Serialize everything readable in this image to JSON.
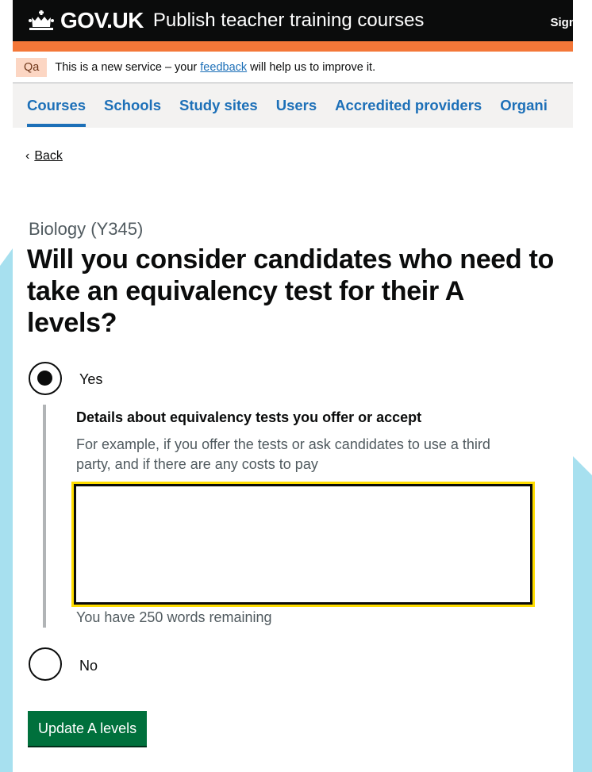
{
  "header": {
    "brand": "GOV.UK",
    "service_name": "Publish teacher training courses",
    "sign_link": "Sign"
  },
  "phase_banner": {
    "tag": "Qa",
    "text_before": "This is a new service – your ",
    "feedback_link": "feedback",
    "text_after": " will help us to improve it."
  },
  "nav": {
    "items": [
      {
        "label": "Courses",
        "active": true
      },
      {
        "label": "Schools"
      },
      {
        "label": "Study sites"
      },
      {
        "label": "Users"
      },
      {
        "label": "Accredited providers"
      },
      {
        "label": "Organi"
      }
    ]
  },
  "back_link": "Back",
  "caption": "Biology (Y345)",
  "heading": "Will you consider candidates who need to take an equivalency test for their A levels?",
  "options": {
    "yes_label": "Yes",
    "no_label": "No",
    "selected": "Yes"
  },
  "details": {
    "label": "Details about equivalency tests you offer or accept",
    "hint": "For example, if you offer the tests or ask candidates to use a third party, and if there are any costs to pay",
    "value": "",
    "word_count": "You have 250 words remaining"
  },
  "submit_button": "Update A levels",
  "colors": {
    "header_bg": "#0b0c0c",
    "header_bar": "#f47738",
    "link": "#1d70b8",
    "button": "#00703c",
    "focus": "#ffdd00",
    "decoration": "#a7e0ef"
  }
}
